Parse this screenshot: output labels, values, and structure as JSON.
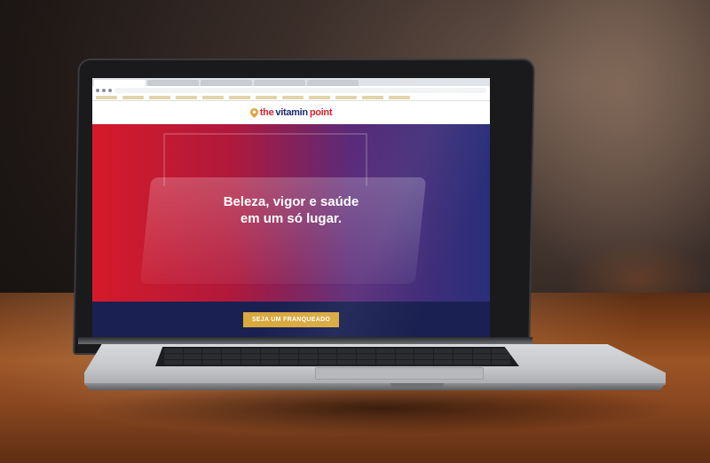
{
  "scene": {
    "description_colors": {
      "background": "#1c1614",
      "table": "#8a4720",
      "brand_red": "#d7242c",
      "brand_navy": "#1f2a6b",
      "cta_gold": "#d9a93e"
    }
  },
  "site": {
    "logo": {
      "the": "the",
      "vitamin": "vitamin",
      "point": "point"
    },
    "hero": {
      "line1": "Beleza, vigor e saúde",
      "line2": "em um só lugar."
    },
    "cta_label": "SEJA UM FRANQUEADO"
  }
}
